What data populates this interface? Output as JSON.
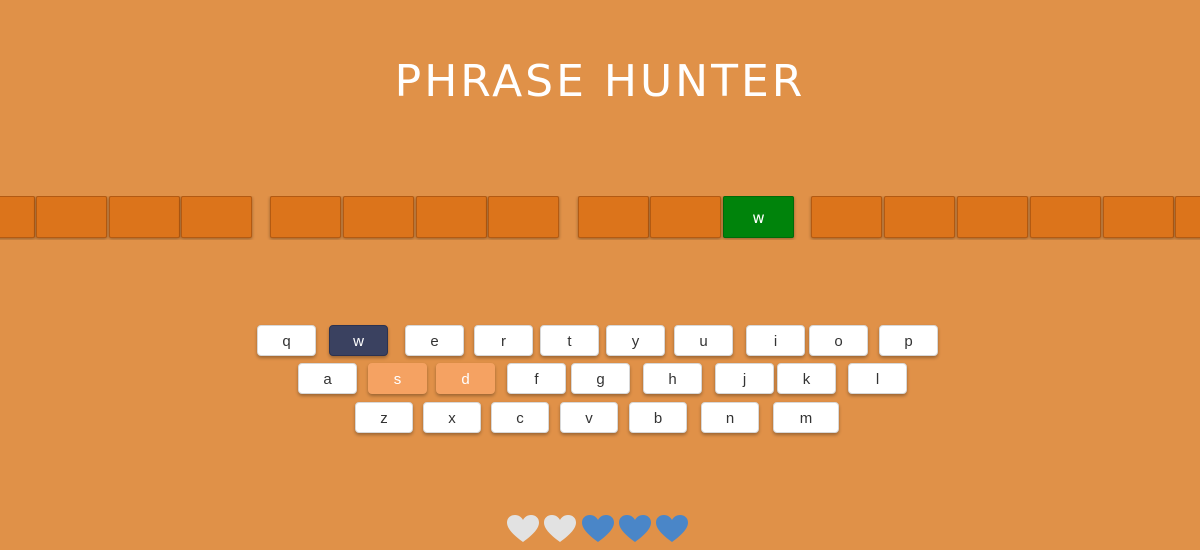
{
  "title": "PHRASE HUNTER",
  "phrase": {
    "tiles": [
      {
        "letter": "",
        "shown": false
      },
      {
        "letter": "",
        "shown": false
      },
      {
        "letter": "",
        "shown": false
      },
      {
        "letter": "",
        "shown": false
      },
      {
        "letter": "",
        "shown": false
      },
      {
        "letter": "",
        "shown": false
      },
      {
        "letter": "",
        "shown": false
      },
      {
        "letter": "",
        "shown": false
      },
      {
        "letter": "",
        "shown": false
      },
      {
        "letter": "",
        "shown": false
      },
      {
        "letter": "w",
        "shown": true
      },
      {
        "letter": "",
        "shown": false
      },
      {
        "letter": "",
        "shown": false
      },
      {
        "letter": "",
        "shown": false
      },
      {
        "letter": "",
        "shown": false
      },
      {
        "letter": "",
        "shown": false
      },
      {
        "letter": "",
        "shown": false
      }
    ]
  },
  "keyboard": {
    "rows": [
      [
        {
          "label": "q",
          "state": "unused"
        },
        {
          "label": "w",
          "state": "chosen"
        },
        {
          "label": "e",
          "state": "unused"
        },
        {
          "label": "r",
          "state": "unused"
        },
        {
          "label": "t",
          "state": "unused"
        },
        {
          "label": "y",
          "state": "unused"
        },
        {
          "label": "u",
          "state": "unused"
        },
        {
          "label": "i",
          "state": "unused"
        },
        {
          "label": "o",
          "state": "unused"
        },
        {
          "label": "p",
          "state": "unused"
        }
      ],
      [
        {
          "label": "a",
          "state": "unused"
        },
        {
          "label": "s",
          "state": "wrong"
        },
        {
          "label": "d",
          "state": "wrong"
        },
        {
          "label": "f",
          "state": "unused"
        },
        {
          "label": "g",
          "state": "unused"
        },
        {
          "label": "h",
          "state": "unused"
        },
        {
          "label": "j",
          "state": "unused"
        },
        {
          "label": "k",
          "state": "unused"
        },
        {
          "label": "l",
          "state": "unused"
        }
      ],
      [
        {
          "label": "z",
          "state": "unused"
        },
        {
          "label": "x",
          "state": "unused"
        },
        {
          "label": "c",
          "state": "unused"
        },
        {
          "label": "v",
          "state": "unused"
        },
        {
          "label": "b",
          "state": "unused"
        },
        {
          "label": "n",
          "state": "unused"
        },
        {
          "label": "m",
          "state": "unused"
        }
      ]
    ]
  },
  "lives": {
    "total": 5,
    "remaining": 3,
    "icon": "heart-icon",
    "lost_color": "#e2e2e2",
    "remaining_color": "#4a86c8"
  },
  "colors": {
    "background": "#e09148",
    "tile": "#dc741b",
    "tile_shown": "#00830b",
    "key_chosen": "#3a4160",
    "key_wrong": "#f5a262"
  }
}
